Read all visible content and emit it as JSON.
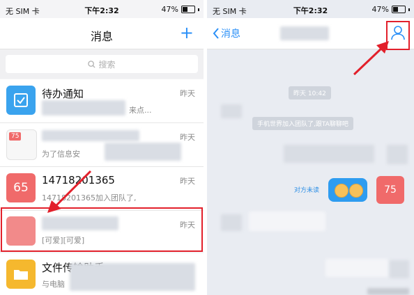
{
  "left": {
    "status": {
      "carrier": "无 SIM 卡",
      "time": "下午2:32",
      "battery": "47%"
    },
    "nav": {
      "title": "消息",
      "plus": "+"
    },
    "search": {
      "placeholder": "搜索"
    },
    "rows": [
      {
        "title": "待办通知",
        "subtitle": "来点...",
        "time": "昨天",
        "avatar_color": "#3aa3ee"
      },
      {
        "title": "",
        "subtitle": "为了信息安",
        "time": "昨天",
        "avatar_text": "75",
        "avatar_color": "#f06a6a"
      },
      {
        "title": "14718201365",
        "subtitle": "14718201365加入团队了,",
        "time": "昨天",
        "avatar_text": "65",
        "avatar_color": "#f06a6a"
      },
      {
        "title": "",
        "subtitle": "[可爱][可爱]",
        "time": "昨天",
        "avatar_color": "#f28a8a"
      },
      {
        "title": "文件传输助手",
        "subtitle": "与电脑",
        "time": "",
        "avatar_color": "#f5b82e"
      }
    ]
  },
  "right": {
    "status": {
      "carrier": "无 SIM 卡",
      "time": "下午2:32",
      "battery": "47%"
    },
    "nav": {
      "back_label": "消息"
    },
    "chat": {
      "timestamp": "昨天 10:42",
      "system_msg": "手机世界加入团队了,跟TA聊聊吧",
      "no_lesson": "对方未读",
      "avatar_text": "75"
    }
  },
  "colors": {
    "accent": "#2a8ff7",
    "annotation": "#e2202b"
  }
}
